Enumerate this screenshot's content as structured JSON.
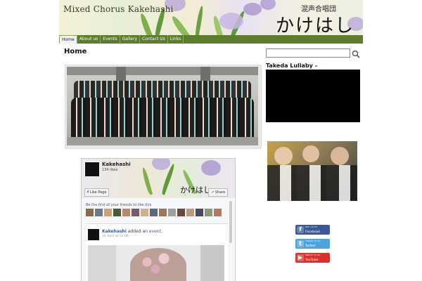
{
  "header": {
    "site_title": "Mixed Chorus Kakehashi",
    "kanji_small": "混声合唱団",
    "kanji_big": "かけはし"
  },
  "nav": {
    "items": [
      "Home",
      "About us",
      "Events",
      "Gallery",
      "Contact Us",
      "Links"
    ]
  },
  "main": {
    "title": "Home"
  },
  "facebook": {
    "page_name": "Kakehashi",
    "likes": "134 likes",
    "like_button": "Like Page",
    "share_button": "Share",
    "friends_text": "Be the first of your friends to like this",
    "post_author": "Kakehashi",
    "post_action": "added an",
    "post_object": "event.",
    "post_date": "16 April at 11:06",
    "avatar_text": "かけはし"
  },
  "sidebar": {
    "widget_title": "Takeda Lullaby –",
    "social": [
      {
        "small": "Join us on",
        "label": "Facebook",
        "icon": "f",
        "color": "#3b5998"
      },
      {
        "small": "Follow us on",
        "label": "Twitter",
        "icon": "t",
        "color": "#4aa3df"
      },
      {
        "small": "Watch us on",
        "label": "YouTube",
        "icon": "▶",
        "color": "#d9302b"
      }
    ]
  },
  "colors": {
    "nav_bg": "#5b7d2c",
    "facebook_blue": "#3b5998"
  }
}
